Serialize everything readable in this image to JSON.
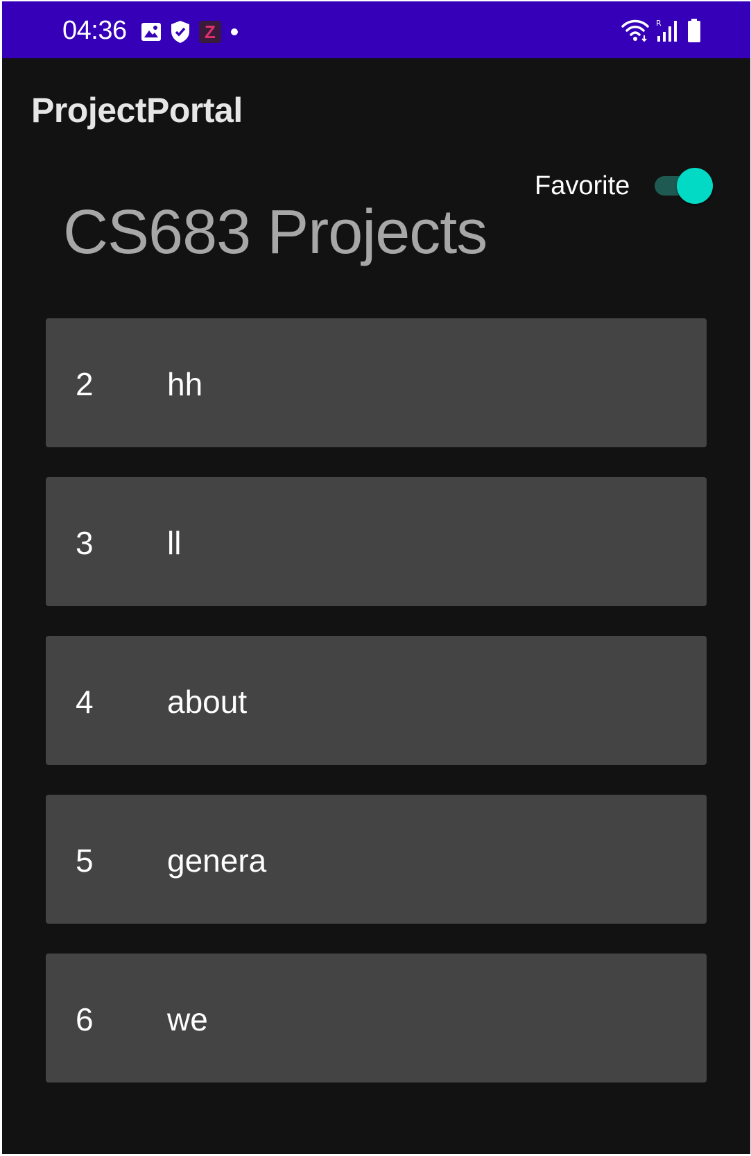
{
  "status_bar": {
    "time": "04:36",
    "left_icons": [
      "image-icon",
      "shield-icon",
      "z-app-icon",
      "dot-icon"
    ],
    "right_icons": [
      "wifi-icon",
      "signal-icon",
      "battery-icon"
    ],
    "z_app_glyph": "Z",
    "background": "#3500b8"
  },
  "app_bar": {
    "title": "ProjectPortal"
  },
  "favorite": {
    "label": "Favorite",
    "checked": true,
    "thumb_color": "#03dac5",
    "track_color": "#1f5a52"
  },
  "heading": {
    "title": "CS683 Projects"
  },
  "projects": [
    {
      "id": "2",
      "name": "hh"
    },
    {
      "id": "3",
      "name": "ll"
    },
    {
      "id": "4",
      "name": "about"
    },
    {
      "id": "5",
      "name": "genera"
    },
    {
      "id": "6",
      "name": "we"
    }
  ],
  "colors": {
    "background": "#121212",
    "card": "#444444",
    "heading_text": "#a7a7a7"
  }
}
